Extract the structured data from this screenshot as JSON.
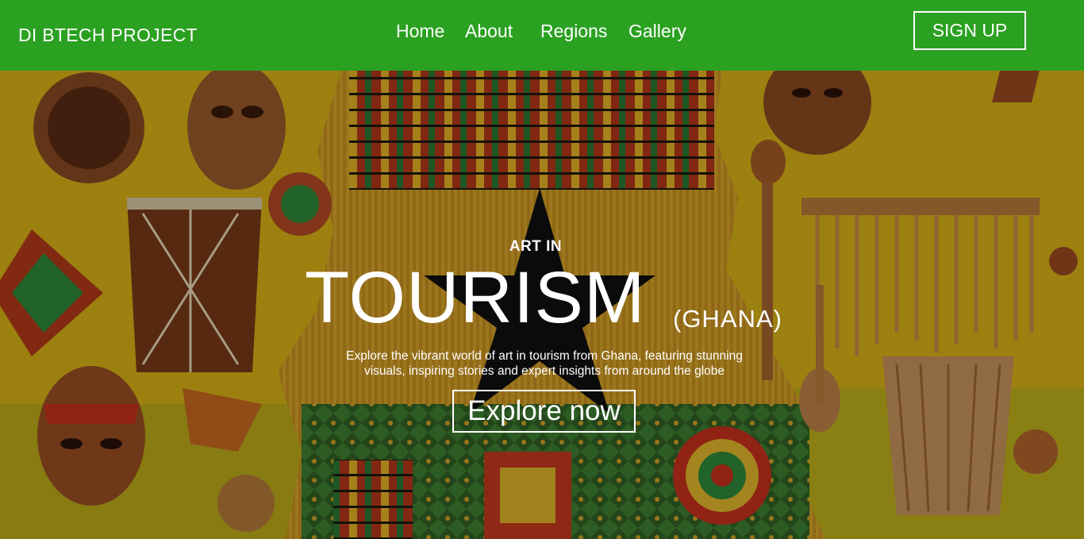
{
  "brand": {
    "name": "DI BTECH PROJECT"
  },
  "nav": {
    "items": [
      {
        "label": "Home"
      },
      {
        "label": "About"
      },
      {
        "label": "Regions"
      },
      {
        "label": "Gallery"
      }
    ],
    "signup_label": "SIGN UP"
  },
  "hero": {
    "eyebrow": "ART IN",
    "headline": "TOURISM",
    "headline_suffix": "(GHANA)",
    "subtitle_line1": "Explore the vibrant world of art in tourism from Ghana, featuring stunning",
    "subtitle_line2": "visuals, inspiring stories and expert insights from around the globe",
    "cta_label": "Explore now"
  },
  "colors": {
    "nav_bg": "#2ba121",
    "text": "#ffffff",
    "hero_yellow": "#e2b51a",
    "flag_red": "#c8311c",
    "flag_green": "#2f8a3a",
    "star": "#101010"
  }
}
